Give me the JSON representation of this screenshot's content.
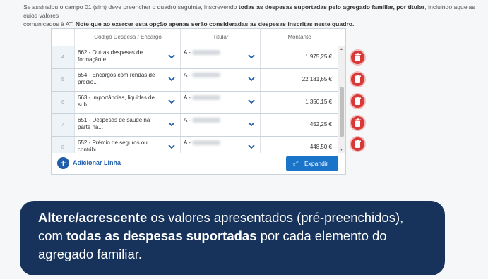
{
  "intro": {
    "line1_a": "Se assinalou o campo 01 (sim) deve preencher o quadro seguinte, inscrevendo ",
    "line1_b": "todas as despesas suportadas pelo agregado familiar, por titular",
    "line1_c": ", incluindo aquelas cujos valores",
    "line2_a": "comunicados à AT. ",
    "line2_b": "Note que ao exercer esta opção apenas serão consideradas as despesas inscritas neste quadro."
  },
  "table": {
    "headers": {
      "code": "Código Despesa / Encargo",
      "titular": "Titular",
      "amount": "Montante"
    },
    "rows": [
      {
        "num": "4",
        "code": "662 - Outras despesas de formação e...",
        "titular": "A -",
        "amount": "1 975,25 €"
      },
      {
        "num": "5",
        "code": "654 - Encargos com rendas de prédio...",
        "titular": "A -",
        "amount": "22 181,65 €"
      },
      {
        "num": "6",
        "code": "663 - Importâncias, liquidas de sub...",
        "titular": "A -",
        "amount": "1 350,15 €"
      },
      {
        "num": "7",
        "code": "651 - Despesas de saúde na parte nã...",
        "titular": "A -",
        "amount": "452,25 €"
      },
      {
        "num": "8",
        "code": "652 - Prémio de seguros ou contribu...",
        "titular": "A -",
        "amount": "448,50 €"
      }
    ]
  },
  "actions": {
    "add_row": "Adicionar Linha",
    "expand": "Expandir"
  },
  "banner": {
    "p1_bold": "Altere/acrescente",
    "p1_rest": " os valores apresentados (pré-preenchidos),",
    "p2_pre": "com ",
    "p2_bold": "todas as despesas suportadas",
    "p2_rest": " por cada elemento do",
    "p3": "agregado familiar."
  },
  "colors": {
    "primary": "#1f5ea8",
    "delete": "#d73838",
    "banner": "#17335c"
  }
}
